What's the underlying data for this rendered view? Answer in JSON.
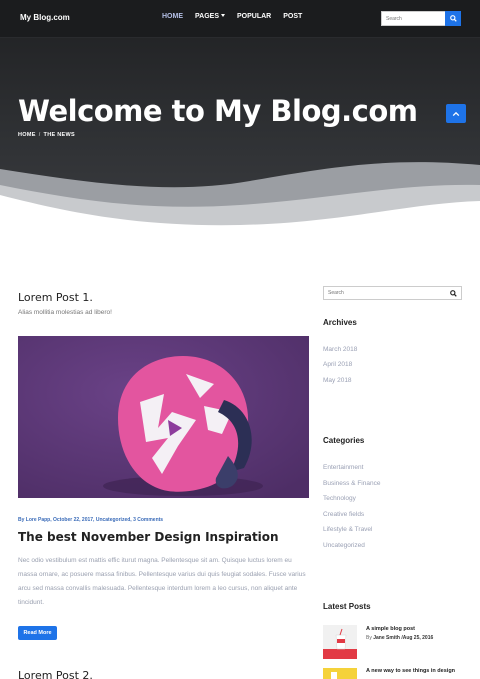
{
  "header": {
    "brand": "My Blog.com",
    "nav": [
      {
        "label": "HOME",
        "active": true
      },
      {
        "label": "PAGES",
        "dropdown": true
      },
      {
        "label": "POPULAR"
      },
      {
        "label": "POST"
      }
    ],
    "search_placeholder": "Search"
  },
  "hero": {
    "title": "Welcome to My Blog.com",
    "breadcrumb": [
      "HOME",
      "THE NEWS"
    ],
    "breadcrumb_sep": "/"
  },
  "posts": {
    "first": {
      "title": "Lorem Post 1.",
      "subtitle": "Alias mollitia molestias ad libero!"
    },
    "second": {
      "title": "Lorem Post 2."
    }
  },
  "article": {
    "meta": {
      "author": "By Lore Papp,",
      "date": "October 22, 2017,",
      "category": "Uncategorized,",
      "comments": "3 Comments"
    },
    "title": "The best November Design Inspiration",
    "excerpt": "Nec odio vestibulum est mattis effic iturut magna. Pellentesque sit am. Quisque luctus lorem eu massa ornare, ac posuere massa finibus. Pellentesque varius dui quis feugiat sodales. Fusce varius arcu sed massa convallis malesuada. Pellentesque interdum lorem a leo cursus, non aliquet ante tincidunt.",
    "read_more": "Read More"
  },
  "sidebar": {
    "search_placeholder": "Search",
    "archives_title": "Archives",
    "archives": [
      "March 2018",
      "April 2018",
      "May 2018"
    ],
    "categories_title": "Categories",
    "categories": [
      "Entertainment",
      "Business & Finance",
      "Technology",
      "Creative fields",
      "Lifestyle & Travel",
      "Uncategorized"
    ],
    "latest_title": "Latest Posts",
    "latest": [
      {
        "title": "A simple blog post",
        "author": "Jane Smith",
        "date": "/Aug 25, 2016"
      },
      {
        "title": "A new way to see things in design"
      }
    ],
    "by_label": "By"
  },
  "colors": {
    "accent": "#1e73e8",
    "nav_active": "#b4bfe6",
    "muted_text": "#9aa0b0",
    "hero_dark": "#1f2022",
    "image_bg": "#5d3977",
    "helmet_pink": "#e3559f"
  },
  "icons": {
    "search": "search-icon",
    "scroll_top": "chevron-up-icon",
    "dropdown": "caret-down-icon"
  }
}
